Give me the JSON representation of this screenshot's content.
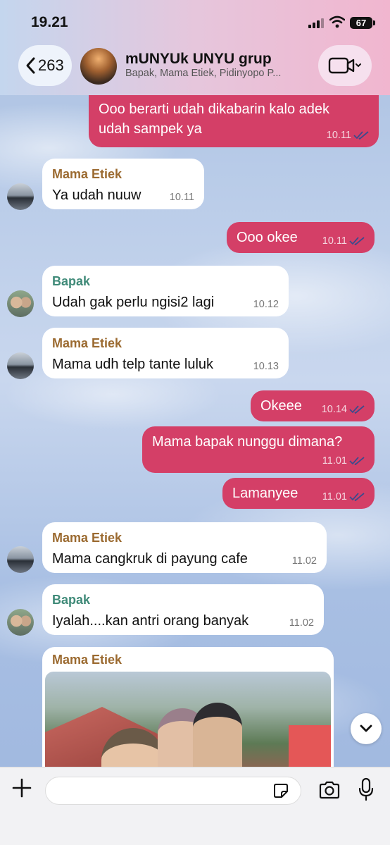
{
  "status_bar": {
    "time": "19.21",
    "battery": "67"
  },
  "header": {
    "back_count": "263",
    "title": "mUNYUk UNYU grup",
    "subtitle": "Bapak, Mama Etiek, Pidinyopo P..."
  },
  "messages": [
    {
      "dir": "out",
      "text_line1": "Ooo berarti udah dikabarin kalo adek",
      "text_line2": "udah sampek ya",
      "time": "10.11"
    },
    {
      "dir": "in",
      "sender": "Mama Etiek",
      "text": "Ya udah nuuw",
      "time": "10.11"
    },
    {
      "dir": "out",
      "text": "Ooo okee",
      "time": "10.11"
    },
    {
      "dir": "in",
      "sender": "Bapak",
      "text": "Udah gak perlu ngisi2 lagi",
      "time": "10.12"
    },
    {
      "dir": "in",
      "sender": "Mama Etiek",
      "text": "Mama udh telp tante luluk",
      "time": "10.13"
    },
    {
      "dir": "out",
      "text": "Okeee",
      "time": "10.14"
    },
    {
      "dir": "out",
      "text": "Mama bapak nunggu dimana?",
      "time": "11.01"
    },
    {
      "dir": "out",
      "text": "Lamanyee",
      "time": "11.01"
    },
    {
      "dir": "in",
      "sender": "Mama Etiek",
      "text": "Mama cangkruk di payung cafe",
      "time": "11.02"
    },
    {
      "dir": "in",
      "sender": "Bapak",
      "text": "Iyalah....kan antri orang banyak",
      "time": "11.02"
    },
    {
      "dir": "in",
      "sender": "Mama Etiek",
      "type": "photo"
    }
  ],
  "icons": {
    "back": "chevron-left-icon",
    "video": "video-camera-icon",
    "plus": "plus-icon",
    "sticker": "sticker-icon",
    "camera": "camera-icon",
    "mic": "microphone-icon",
    "scroll": "chevron-down-icon"
  },
  "colors": {
    "outgoing_bubble": "#d43f67",
    "incoming_bubble": "#ffffff",
    "mama_name": "#9b6a30",
    "bapak_name": "#3f8a78"
  }
}
